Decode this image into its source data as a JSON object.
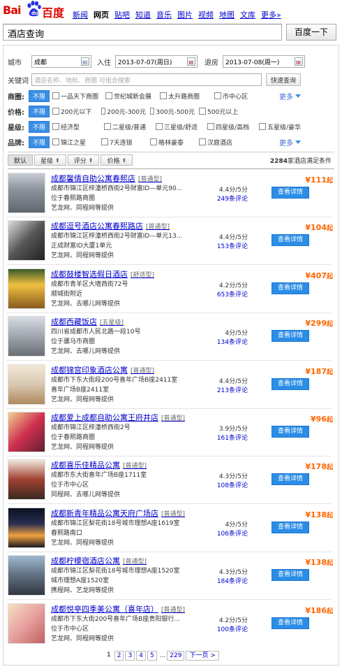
{
  "logo": {
    "text_bai": "Bai",
    "text_du": "百度"
  },
  "nav": [
    "新闻",
    "网页",
    "贴吧",
    "知道",
    "音乐",
    "图片",
    "视频",
    "地图",
    "文库",
    "更多»"
  ],
  "nav_active_index": 1,
  "search": {
    "value": "酒店查询",
    "button": "百度一下"
  },
  "form": {
    "city_label": "城市",
    "city_value": "成都",
    "checkin_label": "入住",
    "checkin_value": "2013-07-07(周日)",
    "checkout_label": "退房",
    "checkout_value": "2013-07-08(周一)",
    "keyword_label": "关键词",
    "keyword_placeholder": "酒店名称、地标、商圈 可组合搜索",
    "search_button": "快速查询"
  },
  "filters": {
    "all_label": "不限",
    "more_label": "更多",
    "rows": [
      {
        "label": "商圈:",
        "options": [
          "一品天下商圈",
          "世纪城新会展",
          "太升路商圈",
          "市中心区"
        ],
        "more": true
      },
      {
        "label": "价格:",
        "options": [
          "200元以下",
          "200元-300元",
          "300元-500元",
          "500元以上"
        ],
        "more": false
      },
      {
        "label": "星级:",
        "options": [
          "经济型",
          "二星级/普通",
          "三星级/舒适",
          "四星级/高档",
          "五星级/豪华"
        ],
        "more": false
      },
      {
        "label": "品牌:",
        "options": [
          "锦江之星",
          "7天连锁",
          "格林豪泰",
          "汉庭酒店"
        ],
        "more": true
      }
    ]
  },
  "sort": {
    "buttons": [
      "默认",
      "星级",
      "评分",
      "价格"
    ],
    "count_prefix": "",
    "count": "2284",
    "count_suffix": "家酒店满足条件"
  },
  "hotels": [
    {
      "name": "成都馨倩自助公寓春熙店",
      "type": "[普通型]",
      "addr": "成都市锦江区梓潼桥西街2号财富ID—单元90...",
      "area": "位于春熙路商圈",
      "source": "艺龙网、同程网等提供",
      "score": "4.4分/5分",
      "reviews": "249条评论",
      "price": "¥111",
      "price_suffix": "起",
      "button": "查看详情"
    },
    {
      "name": "成都逗号酒店公寓春熙路店",
      "type": "[普通型]",
      "addr": "成都市锦江区梓潼桥西街2号财富ID—单元13...",
      "area": "正成财富ID大厦1单元",
      "source": "艺龙网、同程网等提供",
      "score": "4.4分/5分",
      "reviews": "153条评论",
      "price": "¥104",
      "price_suffix": "起",
      "button": "查看详情"
    },
    {
      "name": "成都鼓楼智选假日酒店",
      "type": "[舒适型]",
      "addr": "成都市青羊区大墙西街72号",
      "area": "顺城街附近",
      "source": "艺龙网、去哪儿网等提供",
      "score": "4.2分/5分",
      "reviews": "653条评论",
      "price": "¥407",
      "price_suffix": "起",
      "button": "查看详情"
    },
    {
      "name": "成都西藏饭店",
      "type": "[五星级]",
      "addr": "四川省成都市人民北路一段10号",
      "area": "位于骡马市商圈",
      "source": "艺龙网、去哪儿网等提供",
      "score": "4分/5分",
      "reviews": "134条评论",
      "price": "¥299",
      "price_suffix": "起",
      "button": "查看详情"
    },
    {
      "name": "成都锦宫印象酒店公寓",
      "type": "[普通型]",
      "addr": "成都市下东大街段200号喜年广场B座2411室",
      "area": "喜年广场B座2411室",
      "source": "艺龙网、同程网等提供",
      "score": "4.4分/5分",
      "reviews": "213条评论",
      "price": "¥187",
      "price_suffix": "起",
      "button": "查看详情"
    },
    {
      "name": "成都爱上成都自助公寓王府井店",
      "type": "[普通型]",
      "addr": "成都市锦江区梓潼桥西街2号",
      "area": "位于春熙路商圈",
      "source": "艺龙网、同程网等提供",
      "score": "3.9分/5分",
      "reviews": "161条评论",
      "price": "¥96",
      "price_suffix": "起",
      "button": "查看详情"
    },
    {
      "name": "成都喜乐佳精品公寓",
      "type": "[普通型]",
      "addr": "成都市东大街喜年广场B座1711室",
      "area": "位于市中心区",
      "source": "同程网、去哪儿网等提供",
      "score": "4.3分/5分",
      "reviews": "108条评论",
      "price": "¥178",
      "price_suffix": "起",
      "button": "查看详情"
    },
    {
      "name": "成都新青年精品公寓天府广场店",
      "type": "[普通型]",
      "addr": "成都市锦江区梨花街18号城市理想A座1619室",
      "area": "春熙路南口",
      "source": "艺龙网、同程网等提供",
      "score": "4分/5分",
      "reviews": "106条评论",
      "price": "¥138",
      "price_suffix": "起",
      "button": "查看详情"
    },
    {
      "name": "成都柠檬宿酒店公寓",
      "type": "[普通型]",
      "addr": "成都市锦江区梨花街18号城市理想A座1520室",
      "area": "城市理想A座1520室",
      "source": "携程网、艺龙网等提供",
      "score": "4.3分/5分",
      "reviews": "184条评论",
      "price": "¥138",
      "price_suffix": "起",
      "button": "查看详情"
    },
    {
      "name": "成都悦亭四季美公寓（喜年店）",
      "type": "[普通型]",
      "addr": "成都市下东大街200号喜年广场B座贵阳银行...",
      "area": "位于市中心区",
      "source": "艺龙网、同程网等提供",
      "score": "4.2分/5分",
      "reviews": "100条评论",
      "price": "¥186",
      "price_suffix": "起",
      "button": "查看详情"
    }
  ],
  "pager": {
    "pages": [
      "1",
      "2",
      "3",
      "4",
      "5"
    ],
    "dots": "...",
    "last": "229",
    "next": "下一页 >"
  }
}
